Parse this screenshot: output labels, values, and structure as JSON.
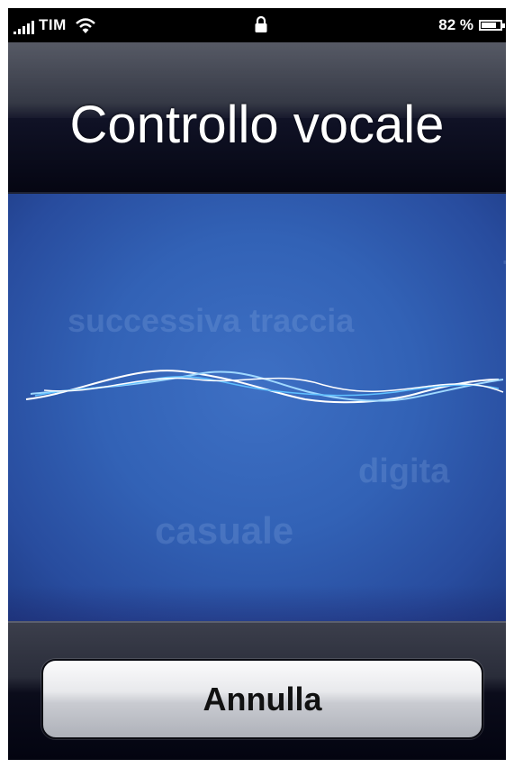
{
  "status_bar": {
    "carrier": "TIM",
    "battery_percent": "82 %",
    "battery_level": 0.82,
    "icons": [
      "signal-bars-icon",
      "wifi-icon",
      "lock-icon",
      "battery-icon"
    ]
  },
  "header": {
    "title": "Controllo vocale"
  },
  "voice_area": {
    "hints": [
      "successiva traccia",
      "digita",
      "casuale",
      "t"
    ],
    "wave_colors": [
      "#ffffff",
      "#9fd8ff",
      "#5fc0ff"
    ]
  },
  "footer": {
    "cancel_label": "Annulla"
  }
}
